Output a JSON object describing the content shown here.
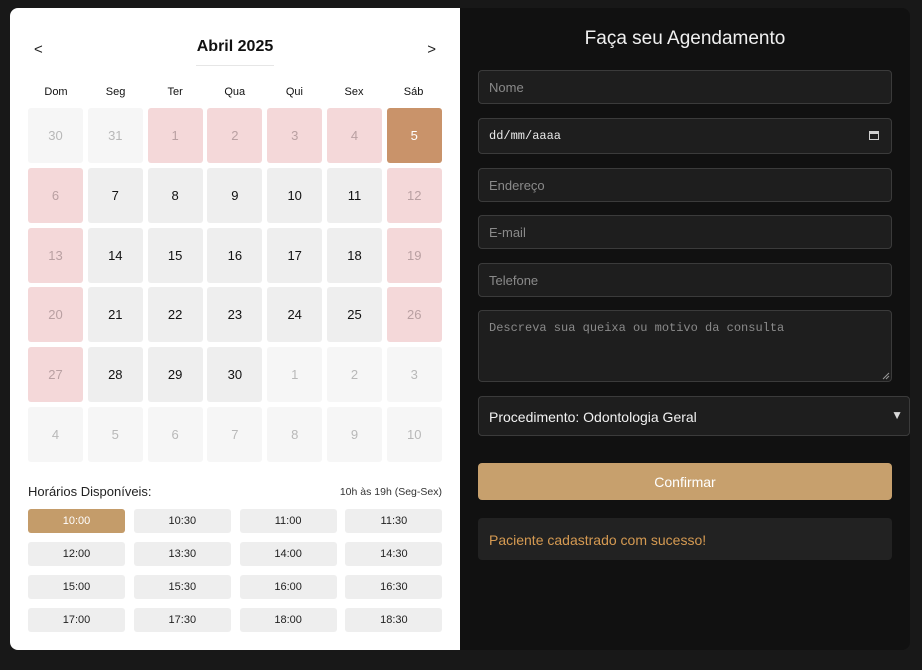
{
  "calendar": {
    "month_title": "Abril 2025",
    "prev_label": "<",
    "next_label": ">",
    "weekdays": [
      "Dom",
      "Seg",
      "Ter",
      "Qua",
      "Qui",
      "Sex",
      "Sáb"
    ],
    "days": [
      {
        "label": "30",
        "state": "other"
      },
      {
        "label": "31",
        "state": "other"
      },
      {
        "label": "1",
        "state": "weekend"
      },
      {
        "label": "2",
        "state": "weekend"
      },
      {
        "label": "3",
        "state": "weekend"
      },
      {
        "label": "4",
        "state": "weekend"
      },
      {
        "label": "5",
        "state": "selected"
      },
      {
        "label": "6",
        "state": "weekend"
      },
      {
        "label": "7",
        "state": "normal"
      },
      {
        "label": "8",
        "state": "normal"
      },
      {
        "label": "9",
        "state": "normal"
      },
      {
        "label": "10",
        "state": "normal"
      },
      {
        "label": "11",
        "state": "normal"
      },
      {
        "label": "12",
        "state": "weekend"
      },
      {
        "label": "13",
        "state": "weekend"
      },
      {
        "label": "14",
        "state": "normal"
      },
      {
        "label": "15",
        "state": "normal"
      },
      {
        "label": "16",
        "state": "normal"
      },
      {
        "label": "17",
        "state": "normal"
      },
      {
        "label": "18",
        "state": "normal"
      },
      {
        "label": "19",
        "state": "weekend"
      },
      {
        "label": "20",
        "state": "weekend"
      },
      {
        "label": "21",
        "state": "normal"
      },
      {
        "label": "22",
        "state": "normal"
      },
      {
        "label": "23",
        "state": "normal"
      },
      {
        "label": "24",
        "state": "normal"
      },
      {
        "label": "25",
        "state": "normal"
      },
      {
        "label": "26",
        "state": "weekend"
      },
      {
        "label": "27",
        "state": "weekend"
      },
      {
        "label": "28",
        "state": "normal"
      },
      {
        "label": "29",
        "state": "normal"
      },
      {
        "label": "30",
        "state": "normal"
      },
      {
        "label": "1",
        "state": "other"
      },
      {
        "label": "2",
        "state": "other"
      },
      {
        "label": "3",
        "state": "other"
      },
      {
        "label": "4",
        "state": "other"
      },
      {
        "label": "5",
        "state": "other"
      },
      {
        "label": "6",
        "state": "other"
      },
      {
        "label": "7",
        "state": "other"
      },
      {
        "label": "8",
        "state": "other"
      },
      {
        "label": "9",
        "state": "other"
      },
      {
        "label": "10",
        "state": "other"
      }
    ]
  },
  "times": {
    "title": "Horários Disponíveis:",
    "range": "10h às 19h (Seg-Sex)",
    "selected": "10:00",
    "slots": [
      "10:00",
      "10:30",
      "11:00",
      "11:30",
      "12:00",
      "13:30",
      "14:00",
      "14:30",
      "15:00",
      "15:30",
      "16:00",
      "16:30",
      "17:00",
      "17:30",
      "18:00",
      "18:30"
    ]
  },
  "form": {
    "title": "Faça seu Agendamento",
    "name_placeholder": "Nome",
    "date_placeholder": "dd/mm/aaaa",
    "address_placeholder": "Endereço",
    "email_placeholder": "E-mail",
    "phone_placeholder": "Telefone",
    "complaint_placeholder": "Descreva sua queixa ou motivo da consulta",
    "procedure_label": "Procedimento: Odontologia Geral",
    "confirm_label": "Confirmar",
    "success_message": "Paciente cadastrado com sucesso!"
  },
  "colors": {
    "selected_day": "#c9936a",
    "weekend_day": "#f4d8d9",
    "accent_button": "#c7a06d",
    "success_text": "#d59a52"
  }
}
